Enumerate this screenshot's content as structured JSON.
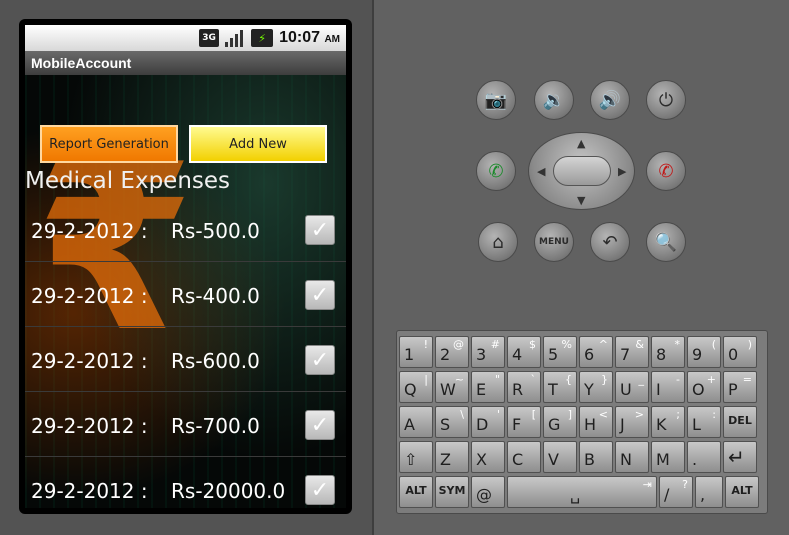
{
  "status_bar": {
    "network": "3G",
    "time": "10:07",
    "ampm": "AM"
  },
  "app": {
    "title": "MobileAccount"
  },
  "buttons": {
    "report": "Report Generation",
    "add_new": "Add New"
  },
  "heading": "Medical  Expenses",
  "expenses": [
    {
      "date": "29-2-2012 :",
      "amount": "Rs-500.0",
      "checked": true
    },
    {
      "date": "29-2-2012 :",
      "amount": "Rs-400.0",
      "checked": true
    },
    {
      "date": "29-2-2012 :",
      "amount": "Rs-600.0",
      "checked": true
    },
    {
      "date": "29-2-2012 :",
      "amount": "Rs-700.0",
      "checked": true
    },
    {
      "date": "29-2-2012 :",
      "amount": "Rs-20000.0",
      "checked": true
    }
  ],
  "hardware_buttons": {
    "menu_label": "MENU"
  },
  "keyboard": {
    "row1": [
      {
        "main": "1",
        "sub": "!"
      },
      {
        "main": "2",
        "sub": "@"
      },
      {
        "main": "3",
        "sub": "#"
      },
      {
        "main": "4",
        "sub": "$"
      },
      {
        "main": "5",
        "sub": "%"
      },
      {
        "main": "6",
        "sub": "^"
      },
      {
        "main": "7",
        "sub": "&"
      },
      {
        "main": "8",
        "sub": "*"
      },
      {
        "main": "9",
        "sub": "("
      },
      {
        "main": "0",
        "sub": ")"
      }
    ],
    "row2": [
      {
        "main": "Q",
        "sub": "|"
      },
      {
        "main": "W",
        "sub": "~"
      },
      {
        "main": "E",
        "sub": "\""
      },
      {
        "main": "R",
        "sub": "`"
      },
      {
        "main": "T",
        "sub": "{"
      },
      {
        "main": "Y",
        "sub": "}"
      },
      {
        "main": "U",
        "sub": "_"
      },
      {
        "main": "I",
        "sub": "-"
      },
      {
        "main": "O",
        "sub": "+"
      },
      {
        "main": "P",
        "sub": "="
      }
    ],
    "row3": [
      {
        "main": "A",
        "sub": ""
      },
      {
        "main": "S",
        "sub": "\\"
      },
      {
        "main": "D",
        "sub": "'"
      },
      {
        "main": "F",
        "sub": "["
      },
      {
        "main": "G",
        "sub": "]"
      },
      {
        "main": "H",
        "sub": "<"
      },
      {
        "main": "J",
        "sub": ">"
      },
      {
        "main": "K",
        "sub": ";"
      },
      {
        "main": "L",
        "sub": ":"
      },
      {
        "main": "DEL",
        "sub": ""
      }
    ],
    "row4": [
      {
        "main": "⇧",
        "sub": ""
      },
      {
        "main": "Z",
        "sub": ""
      },
      {
        "main": "X",
        "sub": ""
      },
      {
        "main": "C",
        "sub": ""
      },
      {
        "main": "V",
        "sub": ""
      },
      {
        "main": "B",
        "sub": ""
      },
      {
        "main": "N",
        "sub": ""
      },
      {
        "main": "M",
        "sub": ""
      },
      {
        "main": ".",
        "sub": ""
      },
      {
        "main": "↵",
        "sub": ""
      }
    ],
    "alt": "ALT",
    "sym": "SYM",
    "at": "@",
    "slash": "/",
    "question": "?",
    "comma": ","
  }
}
